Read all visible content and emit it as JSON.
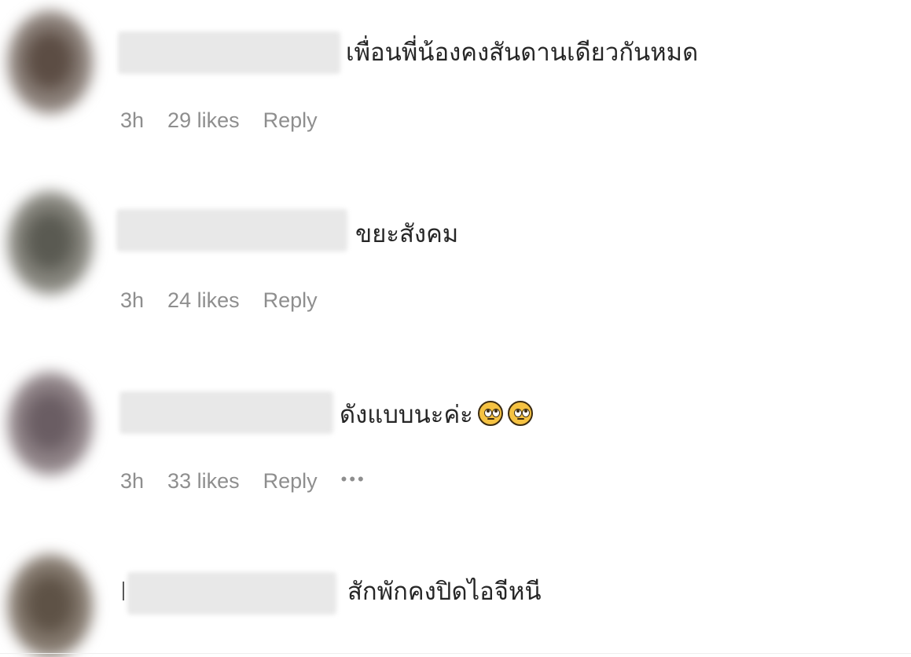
{
  "colors": {
    "text": "#262626",
    "meta": "#8e8e8e",
    "background": "#ffffff",
    "redacted": "#e8e8e8"
  },
  "comments": [
    {
      "username_redacted": true,
      "text": "เพื่อนพี่น้องคงสันดานเดียวกันหมด",
      "time": "3h",
      "likes": "29 likes",
      "reply_label": "Reply",
      "emojis": []
    },
    {
      "username_redacted": true,
      "text": "ขยะสังคม",
      "time": "3h",
      "likes": "24 likes",
      "reply_label": "Reply",
      "emojis": []
    },
    {
      "username_redacted": true,
      "text": "ดังแบบนะค่ะ",
      "time": "3h",
      "likes": "33 likes",
      "reply_label": "Reply",
      "more_label": "•••",
      "emojis": [
        "face-with-rolling-eyes-icon",
        "face-with-rolling-eyes-icon"
      ]
    },
    {
      "username_redacted": true,
      "text": "สักพักคงปิดไอจีหนี"
    }
  ]
}
